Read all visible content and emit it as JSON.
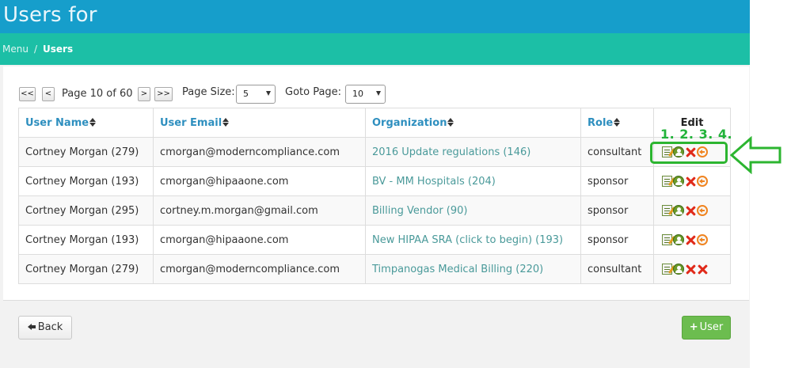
{
  "header": {
    "title": "Users for"
  },
  "breadcrumb": {
    "items": [
      "Menu",
      "Users"
    ]
  },
  "pager": {
    "first": "<<",
    "prev": "<",
    "page_text": "Page 10 of 60",
    "next": ">",
    "last": ">>",
    "page_size_label": "Page Size:",
    "page_size_value": "5",
    "goto_label": "Goto Page:",
    "goto_value": "10"
  },
  "table": {
    "columns": [
      "User Name",
      "User Email",
      "Organization",
      "Role",
      "Edit"
    ],
    "rows": [
      {
        "name": "Cortney Morgan (279)",
        "email": "cmorgan@moderncompliance.com",
        "org": "2016 Update regulations (146)",
        "role": "consultant",
        "actions": [
          "edit-icon",
          "user-icon",
          "delete-icon",
          "undo-icon"
        ]
      },
      {
        "name": "Cortney Morgan (193)",
        "email": "cmorgan@hipaaone.com",
        "org": "BV - MM Hospitals (204)",
        "role": "sponsor",
        "actions": [
          "edit-icon",
          "user-icon",
          "delete-icon",
          "undo-icon"
        ]
      },
      {
        "name": "Cortney Morgan (295)",
        "email": "cortney.m.morgan@gmail.com",
        "org": "Billing Vendor (90)",
        "role": "sponsor",
        "actions": [
          "edit-icon",
          "user-icon",
          "delete-icon",
          "undo-icon"
        ]
      },
      {
        "name": "Cortney Morgan (193)",
        "email": "cmorgan@hipaaone.com",
        "org": "New HIPAA SRA (click to begin) (193)",
        "role": "sponsor",
        "actions": [
          "edit-icon",
          "user-icon",
          "delete-icon",
          "undo-icon"
        ]
      },
      {
        "name": "Cortney Morgan (279)",
        "email": "cmorgan@moderncompliance.com",
        "org": "Timpanogas Medical Billing (220)",
        "role": "consultant",
        "actions": [
          "edit-icon",
          "user-icon",
          "delete-icon",
          "delete-icon"
        ]
      }
    ]
  },
  "annotation": {
    "step_numbers": "1. 2. 3. 4.",
    "color": "#2cb530"
  },
  "footer": {
    "back_label": "Back",
    "add_user_label": "User"
  },
  "colors": {
    "header": "#169ecb",
    "breadcrumb_bar": "#1cbfa6",
    "link": "#2e8fbf",
    "add_button": "#6cbd4f"
  }
}
